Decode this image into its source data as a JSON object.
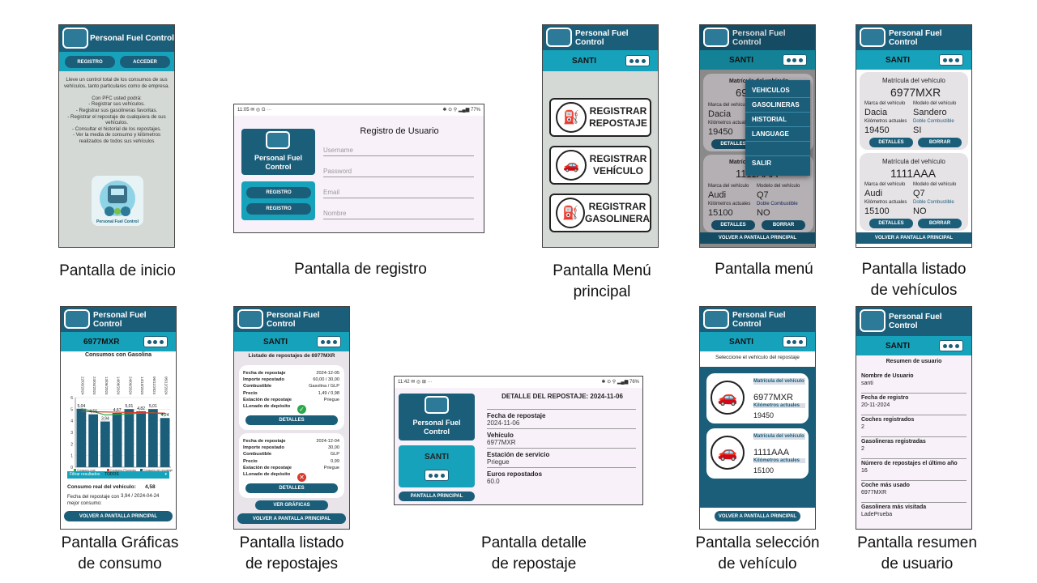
{
  "app_name": "Personal Fuel Control",
  "user": "SANTI",
  "captions": {
    "inicio": "Pantalla de inicio",
    "registro": "Pantalla de registro",
    "menu_principal_1": "Pantalla Menú",
    "menu_principal_2": "principal",
    "menu": "Pantalla menú",
    "listado_vehiculos_1": "Pantalla listado",
    "listado_vehiculos_2": "de vehículos",
    "graficas_1": "Pantalla Gráficas",
    "graficas_2": "de consumo",
    "listado_repostajes_1": "Pantalla listado",
    "listado_repostajes_2": "de repostajes",
    "detalle_1": "Pantalla detalle",
    "detalle_2": "de repostaje",
    "seleccion_1": "Pantalla selección",
    "seleccion_2": "de vehículo",
    "resumen_1": "Pantalla resumen",
    "resumen_2": "de usuario"
  },
  "inicio": {
    "registro_btn": "REGISTRO",
    "acceder_btn": "ACCEDER",
    "text": "Lleve un control total de los consumos de sus vehículos, tanto particulares como de empresa.\n\nCon PFC usted podrá:\n- Registrar sus vehículos.\n- Registrar sus gasolineras favoritas.\n- Registrar el repostaje de cualquiera de sus vehículos.\n- Consultar el historial de los repostajes.\n- Ver la media de consumo y kilómetros realizados de todos sus vehículos",
    "logo_text": "Personal Fuel Control"
  },
  "registro": {
    "status": "11:05 ✉ ◎ G ···",
    "status_right": "✱ ⊙ ⚲ ▂▄▆ 77%",
    "title": "Registro de Usuario",
    "logo_title": "Personal Fuel Control",
    "btn1": "REGISTRO",
    "btn2": "REGISTRO",
    "username": "Username",
    "password": "Password",
    "email": "Email",
    "nombre": "Nombre"
  },
  "menu_principal": {
    "b1": "REGISTRAR REPOSTAJE",
    "b2": "REGISTRAR VEHÍCULO",
    "b3": "REGISTRAR GASOLINERA"
  },
  "menu": {
    "items": [
      "VEHICULOS",
      "GASOLINERAS",
      "HISTORIAL",
      "LANGUAGE",
      "",
      "SALIR"
    ],
    "volver": "VOLVER A PANTALLA PRINCIPAL",
    "plate_label": "Matrícula del vehículo",
    "plate1": "6977MXR",
    "plate2": "1111AAA",
    "marca_label": "Marca del vehículo",
    "km_label": "Kilómetros actuales",
    "marca1": "Dacia",
    "km1": "19450",
    "marca2": "Audi",
    "modelo2": "Q7",
    "km2": "15100",
    "doble2": "NO",
    "detalles": "DETALLES",
    "borrar": "BORRAR",
    "modelo_label": "Modelo del vehículo",
    "doble_label": "Doble Combustible"
  },
  "vehiculos": {
    "plate_label": "Matrícula del vehículo",
    "marca_label": "Marca del vehículo",
    "modelo_label": "Modelo del vehículo",
    "km_label": "Kilómetros actuales",
    "doble_label": "Doble Combustible",
    "v1": {
      "plate": "6977MXR",
      "marca": "Dacia",
      "modelo": "Sandero",
      "km": "19450",
      "doble": "SI"
    },
    "v2": {
      "plate": "1111AAA",
      "marca": "Audi",
      "modelo": "Q7",
      "km": "15100",
      "doble": "NO"
    },
    "detalles": "DETALLES",
    "borrar": "BORRAR",
    "volver": "VOLVER A PANTALLA PRINCIPAL"
  },
  "graficas": {
    "plate": "6977MXR",
    "title": "Consumos con Gasolina",
    "filter_label": "Filtrar resultados",
    "filter_value": "TODOS",
    "legend": [
      "Consumo real",
      "Consumo Promedio",
      "Consumo de repostaje"
    ],
    "consumo_label": "Consumo real del vehículo:",
    "consumo_value": "4,58",
    "mejor_label": "Fecha del repostaje con mejor consumo:",
    "mejor_value": "3,94 / 2024-04-24",
    "volver": "VOLVER A PANTALLA PRINCIPAL"
  },
  "chart_data": {
    "type": "bar",
    "title": "Consumos con Gasolina",
    "categories": [
      "22/03/2024",
      "24/04/2024",
      "13/06/2024",
      "14/08/2024",
      "24/09/2024",
      "14/10/2024",
      "06/11/2024",
      "05/12/2024"
    ],
    "series": [
      {
        "name": "Consumo de repostaje",
        "values": [
          5.04,
          4.56,
          3.94,
          4.67,
          5.01,
          4.82,
          5.01,
          4.24
        ]
      },
      {
        "name": "Consumo real",
        "values": [
          5.04,
          4.8,
          4.5,
          4.55,
          4.6,
          4.65,
          4.7,
          4.58
        ]
      },
      {
        "name": "Consumo Promedio",
        "values": [
          4.8,
          4.78,
          4.76,
          4.74,
          4.72,
          4.7,
          4.68,
          4.66
        ]
      }
    ],
    "data_labels": [
      "5,04",
      "4,56",
      "3,94",
      "4,67",
      "5,01",
      "4,82",
      "5,01",
      "4,24"
    ],
    "ylim": [
      0,
      6
    ],
    "yticks": [
      "0",
      "1",
      "2",
      "3",
      "4",
      "5",
      "6"
    ],
    "colors": {
      "bars": "#1b5e7a",
      "real": "#2aa84a",
      "promedio": "#d83b2b"
    }
  },
  "repostajes": {
    "title": "Listado de repostajes de 6977MXR",
    "labels": [
      "Fecha de repostaje",
      "Importe repostado",
      "Combustible",
      "Precio",
      "Estación de repostaje",
      "LLenado de depósito"
    ],
    "r1": [
      "2024-12-05",
      "60,00 / 30,00",
      "Gasolina / GLP",
      "1,49 / 0,98",
      "Priegue"
    ],
    "r2": [
      "2024-12-04",
      "30,00",
      "GLP",
      "0,99",
      "Priegue"
    ],
    "detalles": "DETALLES",
    "ver_graficas": "VER GRÁFICAS",
    "volver": "VOLVER A PANTALLA PRINCIPAL"
  },
  "detalle": {
    "status": "11:42 ✉ ◎ ⊞ ···",
    "status_right": "✱ ⊙ ⚲ ▂▄▆ 76%",
    "title": "DETALLE DEL REPOSTAJE: 2024-11-06",
    "logo_title": "Personal Fuel Control",
    "user": "SANTI",
    "main_btn": "PANTALLA PRINCIPAL",
    "f1_label": "Fecha de repostaje",
    "f1_value": "2024-11-06",
    "f2_label": "Vehículo",
    "f2_value": "6977MXR",
    "f3_label": "Estación de servicio",
    "f3_value": "Priegue",
    "f4_label": "Euros repostados",
    "f4_value": "60.0"
  },
  "seleccion": {
    "title": "Seleccione el vehículo del repostaje",
    "plate_label": "Matrícula del vehículo",
    "km_label": "Kilómetros actuales",
    "v1_plate": "6977MXR",
    "v1_km": "19450",
    "v2_plate": "1111AAA",
    "v2_km": "15100",
    "volver": "VOLVER A PANTALLA PRINCIPAL"
  },
  "resumen": {
    "title": "Resumen de usuario",
    "items": [
      {
        "label": "Nombre de Usuario",
        "value": "santi"
      },
      {
        "label": "Fecha de registro",
        "value": "20-11-2024"
      },
      {
        "label": "Coches registrados",
        "value": "2"
      },
      {
        "label": "Gasolineras registradas",
        "value": "2"
      },
      {
        "label": "Número de repostajes el último año",
        "value": "16"
      },
      {
        "label": "Coche más usado",
        "value": "6977MXR"
      },
      {
        "label": "Gasolinera más visitada",
        "value": "LadePrueba"
      }
    ]
  }
}
